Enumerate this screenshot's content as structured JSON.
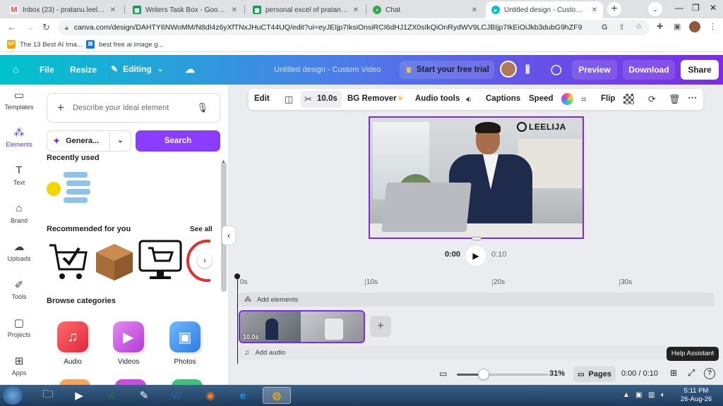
{
  "browser": {
    "tabs": [
      {
        "title": "Inbox (23) - pratanu.leelija@gm",
        "icon": "gmail-icon",
        "color": "#ea4335"
      },
      {
        "title": "Writers Task Box - Google Shee",
        "icon": "sheets-icon",
        "color": "#0f9d58"
      },
      {
        "title": "personal excel of pratanu ban",
        "icon": "sheets-icon",
        "color": "#0f9d58"
      },
      {
        "title": "Chat",
        "icon": "chat-icon",
        "color": "#34a853"
      },
      {
        "title": "Untitled design - Custom Vide",
        "icon": "canva-icon",
        "color": "#00c4cc"
      }
    ],
    "url": "canva.com/design/DAHTY6NWoMM/N8dI4z6yXfTNxJHuCT44UQ/edit?ui=eyJEIjp7IksiOnsiRCI6dHJ1ZX0sIkQiOnRydWV9LCJBIjp7IkEiOiJkb3dubG9hZF9tcDRfd...",
    "bookmarks": [
      {
        "label": "The 13 Best AI Ima...",
        "icon": "gf-icon",
        "color": "#f4a300"
      },
      {
        "label": "best free ai image g...",
        "icon": "doc-icon",
        "color": "#1a73e8"
      }
    ]
  },
  "canva": {
    "header": {
      "file": "File",
      "resize": "Resize",
      "editing": "Editing",
      "title": "Untitled design - Custom Video",
      "trial": "Start your free trial",
      "preview": "Preview",
      "download": "Download",
      "share": "Share"
    },
    "rail": [
      {
        "label": "Templates",
        "icon": "templates-icon"
      },
      {
        "label": "Elements",
        "icon": "elements-icon"
      },
      {
        "label": "Text",
        "icon": "text-icon"
      },
      {
        "label": "Brand",
        "icon": "brand-icon"
      },
      {
        "label": "Uploads",
        "icon": "uploads-icon"
      },
      {
        "label": "Tools",
        "icon": "tools-icon"
      },
      {
        "label": "Projects",
        "icon": "projects-icon"
      },
      {
        "label": "Apps",
        "icon": "apps-icon"
      }
    ],
    "panel": {
      "search_placeholder": "Describe your ideal element",
      "generate": "Genera...",
      "search_button": "Search",
      "recently_used": "Recently used",
      "recommended": "Recommended for you",
      "see_all": "See all",
      "browse": "Browse categories",
      "categories": [
        {
          "label": "Audio",
          "icon": "music-icon",
          "color": "#f0434f"
        },
        {
          "label": "Videos",
          "icon": "video-play-icon",
          "color": "#c74ee0"
        },
        {
          "label": "Photos",
          "icon": "photo-icon",
          "color": "#3b8ee8"
        }
      ]
    },
    "toolbar": {
      "edit": "Edit",
      "duration": "10.0s",
      "bg_remover": "BG Remover",
      "audio_tools": "Audio tools",
      "captions": "Captions",
      "speed": "Speed",
      "flip": "Flip"
    },
    "canvas": {
      "logo": "LEELIJA"
    },
    "playback": {
      "current": "0:00",
      "total": "0:10"
    },
    "timeline": {
      "ticks": [
        "0s",
        "10s",
        "20s",
        "30s"
      ],
      "add_elements": "Add elements",
      "add_audio": "Add audio",
      "clip_duration": "10.0s"
    },
    "status": {
      "zoom": "31%",
      "zoom_fraction": 0.31,
      "pages": "Pages",
      "time": "0:00 / 0:10",
      "help": "Help Assistant"
    }
  },
  "taskbar": {
    "time": "5:11 PM",
    "date": "26-Aug-26"
  }
}
